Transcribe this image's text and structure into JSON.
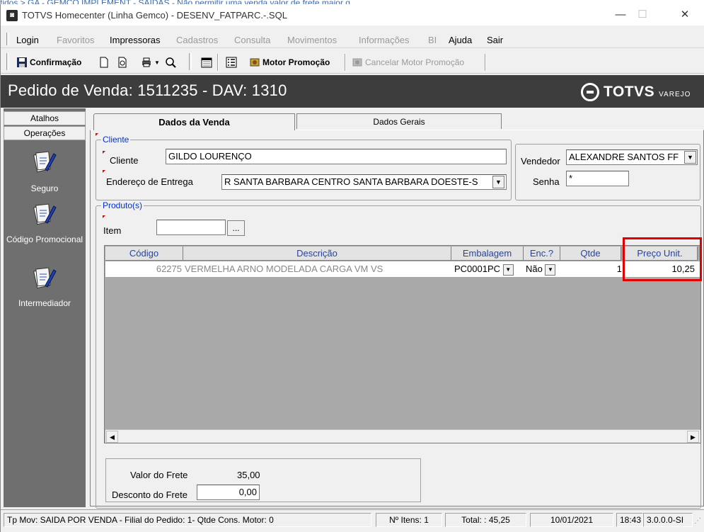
{
  "background_breadcrumb": "tidos  >  GA - GEMCO IMPLEMENT - SAIDAS - Não permitir uma venda valor de frete maior q",
  "window": {
    "title": "TOTVS Homecenter (Linha Gemco) - DESENV_FATPARC.-.SQL",
    "minimize": "—",
    "maximize": "☐",
    "close": "✕"
  },
  "menu": [
    {
      "label": "Login",
      "enabled": true
    },
    {
      "label": "Favoritos",
      "enabled": false
    },
    {
      "label": "Impressoras",
      "enabled": true
    },
    {
      "label": "Cadastros",
      "enabled": false
    },
    {
      "label": "Consulta",
      "enabled": false
    },
    {
      "label": "Movimentos",
      "enabled": false
    },
    {
      "label": "Informações",
      "enabled": false
    },
    {
      "label": "BI",
      "enabled": false
    },
    {
      "label": "Ajuda",
      "enabled": true
    },
    {
      "label": "Sair",
      "enabled": true
    }
  ],
  "toolbar": {
    "confirmacao": "Confirmação",
    "motor_promocao": "Motor Promoção",
    "cancelar_motor_promocao": "Cancelar Motor Promoção"
  },
  "header": {
    "title": "Pedido de Venda: 1511235  - DAV: 1310",
    "logo_word": "TOTVS",
    "logo_sub": "VAREJO"
  },
  "leftnav": {
    "tab_atalhos": "Atalhos",
    "tab_operacoes": "Operações",
    "items": [
      {
        "label": "Seguro",
        "icon": "document-pencil-icon"
      },
      {
        "label": "Código Promocional",
        "icon": "document-pencil-icon"
      },
      {
        "label": "Intermediador",
        "icon": "document-pencil-icon"
      }
    ]
  },
  "tabs": {
    "dados_venda": "Dados da Venda",
    "dados_gerais": "Dados Gerais"
  },
  "cliente": {
    "group_label": "Cliente",
    "cliente_label": "Cliente",
    "cliente_value": "GILDO LOURENÇO",
    "endereco_label": "Endereço de Entrega",
    "endereco_value": "R  SANTA BARBARA CENTRO SANTA BARBARA DOESTE-S",
    "vendedor_label": "Vendedor",
    "vendedor_value": "ALEXANDRE SANTOS FF",
    "senha_label": "Senha",
    "senha_value": "*"
  },
  "produtos": {
    "group_label": "Produto(s)",
    "item_label": "Item",
    "item_value": "",
    "browse_label": "...",
    "columns": [
      "Código",
      "Descrição",
      "Embalagem",
      "Enc.?",
      "Qtde",
      "Preço Unit."
    ],
    "rows": [
      {
        "codigo": "62275",
        "descricao": "VERMELHA ARNO MODELADA CARGA  VM VS",
        "embalagem": "PC0001PC",
        "enc": "Não",
        "qtde": "1",
        "preco": "10,25"
      }
    ]
  },
  "frete": {
    "valor_label": "Valor do Frete",
    "valor_value": "35,00",
    "desconto_label": "Desconto do Frete",
    "desconto_value": "0,00"
  },
  "status": {
    "tp_mov": "Tp Mov: SAIDA POR VENDA - Filial do Pedido: 1-  Qtde Cons. Motor: 0",
    "itens": "Nº Itens: 1",
    "total": "Total: : 45,25",
    "date": "10/01/2021",
    "time": "18:43",
    "version": "3.0.0.0-SI"
  },
  "colors": {
    "header_bg": "#3d3d3d",
    "label_blue": "#0033cc",
    "highlight": "#e00000"
  }
}
